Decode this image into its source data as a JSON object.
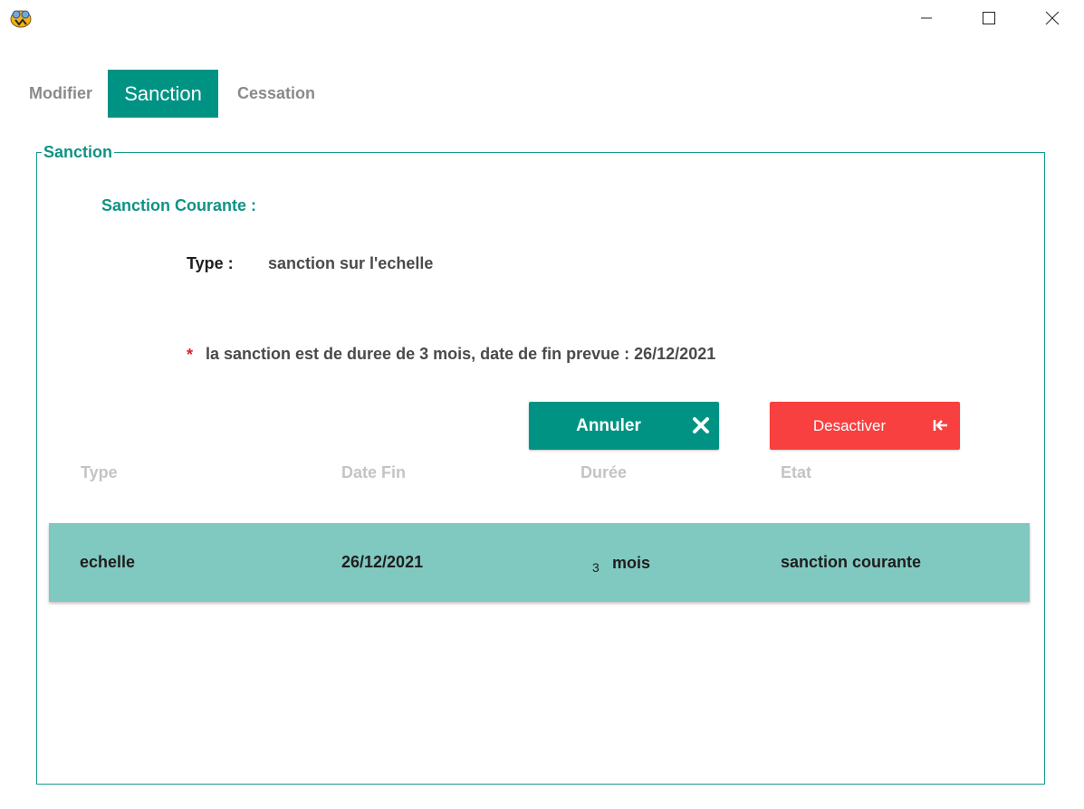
{
  "window": {
    "icon": "app-logo-icon",
    "controls": [
      "minimize-icon",
      "maximize-icon",
      "close-icon"
    ]
  },
  "tabs": [
    {
      "label": "Modifier",
      "active": false
    },
    {
      "label": "Sanction",
      "active": true
    },
    {
      "label": "Cessation",
      "active": false
    }
  ],
  "group": {
    "legend": "Sanction",
    "current_label": "Sanction Courante :",
    "type_label": "Type :",
    "type_value": "sanction sur l'echelle",
    "note_marker": "*",
    "note": "la sanction est de duree de 3 mois, date de fin prevue : 26/12/2021"
  },
  "buttons": {
    "annuler": {
      "label": "Annuler",
      "icon": "close-x-icon",
      "color": "#009384"
    },
    "desactiver": {
      "label": "Desactiver",
      "icon": "exit-arrow-icon",
      "color": "#f7403f"
    }
  },
  "table": {
    "headers": [
      "Type",
      "Date Fin",
      "Durée",
      "Etat"
    ],
    "rows": [
      {
        "type": "echelle",
        "date_fin": "26/12/2021",
        "duree_value": "3",
        "duree_unit": "mois",
        "etat": "sanction courante"
      }
    ]
  },
  "colors": {
    "accent": "#009384",
    "row_highlight": "#80c9c1",
    "danger": "#f7403f"
  }
}
